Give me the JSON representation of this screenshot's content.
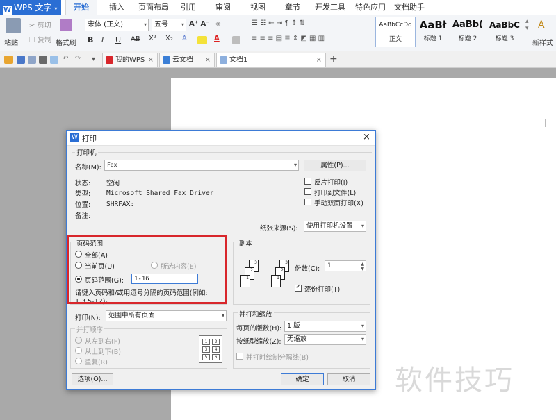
{
  "app": {
    "button_label": "WPS 文字",
    "logo": "W"
  },
  "menu_tabs": [
    "开始",
    "插入",
    "页面布局",
    "引用",
    "审阅",
    "视图",
    "章节",
    "开发工具",
    "特色应用",
    "文档助手"
  ],
  "ribbon": {
    "paste": "粘贴",
    "cut": "剪切",
    "copy": "复制",
    "format_painter": "格式刷",
    "font_name": "宋体 (正文)",
    "font_size": "五号",
    "bold": "B",
    "italic": "I",
    "underline": "U",
    "strike": "AB",
    "superscript": "X²",
    "subscript": "X₂",
    "styles": [
      {
        "sample": "AaBbCcDd",
        "name": "正文"
      },
      {
        "sample": "AaBł",
        "name": "标题 1"
      },
      {
        "sample": "AaBb(",
        "name": "标题 2"
      },
      {
        "sample": "AaBbC",
        "name": "标题 3"
      }
    ],
    "new_style": "新样式"
  },
  "doc_tabs": [
    {
      "label": "我的WPS"
    },
    {
      "label": "云文档"
    },
    {
      "label": "文档1"
    }
  ],
  "dialog": {
    "title": "打印",
    "printer": {
      "group": "打印机",
      "name_label": "名称(M):",
      "name_value": "Fax",
      "properties_btn": "属性(P)...",
      "status_label": "状态:",
      "status_value": "空闲",
      "type_label": "类型:",
      "type_value": "Microsoft Shared Fax Driver",
      "location_label": "位置:",
      "location_value": "SHRFAX:",
      "comment_label": "备注:",
      "reverse": "反片打印(I)",
      "to_file": "打印到文件(L)",
      "duplex": "手动双面打印(X)",
      "source_label": "纸张来源(S):",
      "source_value": "使用打印机设置"
    },
    "range": {
      "group": "页码范围",
      "all": "全部(A)",
      "current": "当前页(U)",
      "selection": "所选内容(E)",
      "pages": "页码范围(G):",
      "pages_value": "1-16",
      "hint": "请键入页码和/或用逗号分隔的页码范围(例如:",
      "hint2": "1,3,5-12)。"
    },
    "copies": {
      "group": "副本",
      "count_label": "份数(C):",
      "count_value": "1",
      "collate": "逐份打印(T)"
    },
    "print_what": {
      "label": "打印(N):",
      "value": "范围中所有页面"
    },
    "order": {
      "group": "并打顺序",
      "ltr": "从左到右(F)",
      "ttb": "从上到下(B)",
      "repeat": "重复(R)"
    },
    "zoom": {
      "group": "并打和缩放",
      "pages_per_sheet_label": "每页的版数(H):",
      "pages_per_sheet_value": "1 版",
      "scale_label": "按纸型缩放(Z):",
      "scale_value": "无缩放",
      "draw_lines": "并打时绘制分隔线(B)"
    },
    "options_btn": "选项(O)...",
    "ok_btn": "确定",
    "cancel_btn": "取消"
  },
  "watermark": "软件技巧",
  "colors": {
    "accent": "#2a6ed4",
    "highlight": "#d8262b"
  }
}
